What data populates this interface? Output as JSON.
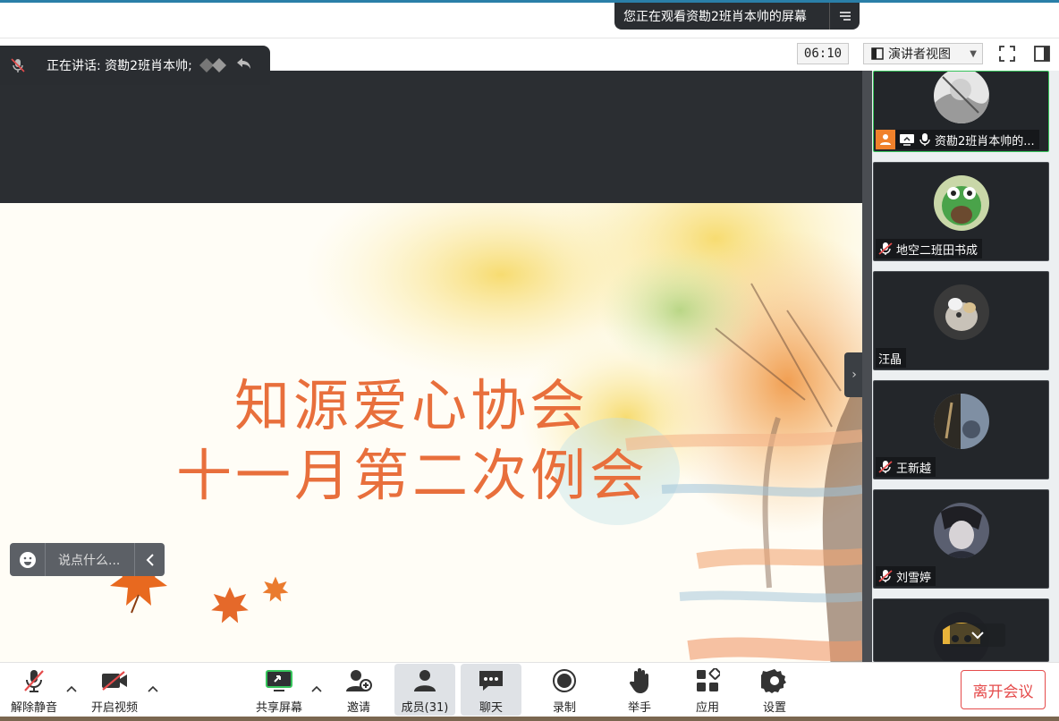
{
  "banner": {
    "text": "您正在观看资勘2班肖本帅的屏幕",
    "menu_icon": "menu-lines-icon"
  },
  "toolbar": {
    "timer": "06:10",
    "view_mode": "演讲者视图",
    "fullscreen_icon": "fullscreen-icon",
    "panel_icon": "side-panel-icon"
  },
  "speaking": {
    "label": "正在讲话: 资勘2班肖本帅;"
  },
  "slide": {
    "title_line1": "知源爱心协会",
    "title_line2": "十一月第二次例会"
  },
  "chat": {
    "placeholder": "说点什么..."
  },
  "participants": [
    {
      "name": "资勘2班肖本帅的...",
      "muted": false,
      "presenting": true
    },
    {
      "name": "地空二班田书成",
      "muted": true,
      "presenting": false
    },
    {
      "name": "汪晶",
      "muted": false,
      "presenting": false
    },
    {
      "name": "王新越",
      "muted": true,
      "presenting": false
    },
    {
      "name": "刘雪婷",
      "muted": true,
      "presenting": false
    },
    {
      "name": "",
      "muted": false,
      "presenting": false
    }
  ],
  "controls": {
    "unmute": "解除静音",
    "start_video": "开启视频",
    "share_screen": "共享屏幕",
    "invite": "邀请",
    "members": "成员(31)",
    "chat": "聊天",
    "record": "录制",
    "raise_hand": "举手",
    "apps": "应用",
    "settings": "设置",
    "leave": "离开会议"
  },
  "colors": {
    "accent": "#35c35a",
    "title": "#e86f3c",
    "leave": "#e54b4b",
    "dark": "#2b2e32"
  }
}
